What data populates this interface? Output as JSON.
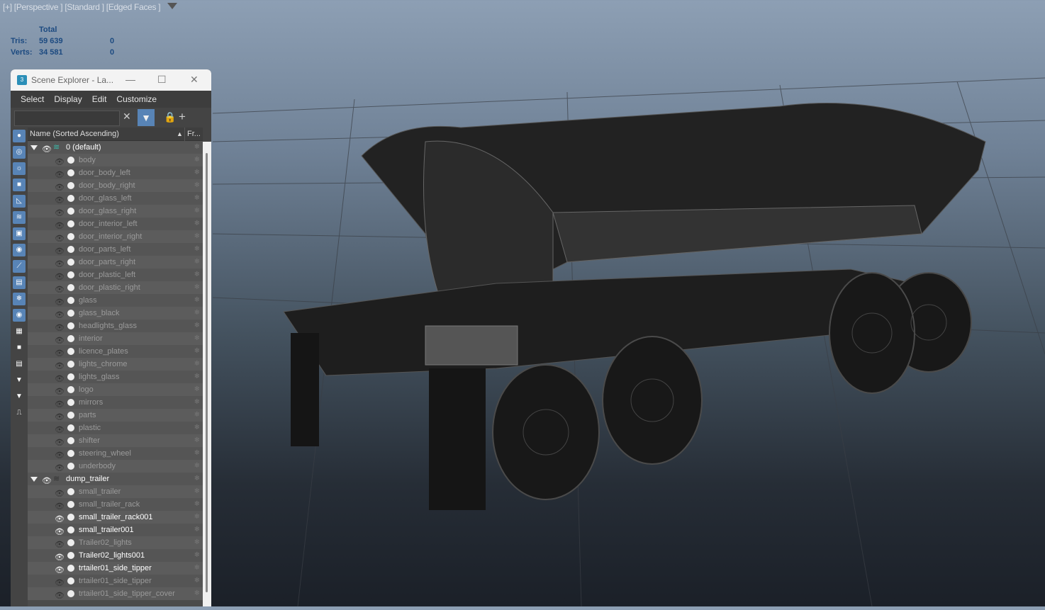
{
  "viewport": {
    "label": "[+] [Perspective ] [Standard ] [Edged Faces ]",
    "stats": {
      "header": "Total",
      "tris_label": "Tris:",
      "tris_total": "59 639",
      "tris_sel": "0",
      "verts_label": "Verts:",
      "verts_total": "34 581",
      "verts_sel": "0"
    }
  },
  "window": {
    "title": "Scene Explorer - La...",
    "app_icon": "3",
    "menu": [
      "Select",
      "Display",
      "Edit",
      "Customize"
    ],
    "search_placeholder": "",
    "column_name": "Name (Sorted Ascending)",
    "column_frozen": "Fr..."
  },
  "layers": [
    {
      "name": "0 (default)",
      "items": [
        {
          "name": "body",
          "visible": false
        },
        {
          "name": "door_body_left",
          "visible": false
        },
        {
          "name": "door_body_right",
          "visible": false
        },
        {
          "name": "door_glass_left",
          "visible": false
        },
        {
          "name": "door_glass_right",
          "visible": false
        },
        {
          "name": "door_interior_left",
          "visible": false
        },
        {
          "name": "door_interior_right",
          "visible": false
        },
        {
          "name": "door_parts_left",
          "visible": false
        },
        {
          "name": "door_parts_right",
          "visible": false
        },
        {
          "name": "door_plastic_left",
          "visible": false
        },
        {
          "name": "door_plastic_right",
          "visible": false
        },
        {
          "name": "glass",
          "visible": false
        },
        {
          "name": "glass_black",
          "visible": false
        },
        {
          "name": "headlights_glass",
          "visible": false
        },
        {
          "name": "interior",
          "visible": false
        },
        {
          "name": "licence_plates",
          "visible": false
        },
        {
          "name": "lights_chrome",
          "visible": false
        },
        {
          "name": "lights_glass",
          "visible": false
        },
        {
          "name": "logo",
          "visible": false
        },
        {
          "name": "mirrors",
          "visible": false
        },
        {
          "name": "parts",
          "visible": false
        },
        {
          "name": "plastic",
          "visible": false
        },
        {
          "name": "shifter",
          "visible": false
        },
        {
          "name": "steering_wheel",
          "visible": false
        },
        {
          "name": "underbody",
          "visible": false
        }
      ]
    },
    {
      "name": "dump_trailer",
      "items": [
        {
          "name": "small_trailer",
          "visible": false
        },
        {
          "name": "small_trailer_rack",
          "visible": false
        },
        {
          "name": "small_trailer_rack001",
          "visible": true
        },
        {
          "name": "small_trailer001",
          "visible": true
        },
        {
          "name": "Trailer02_lights",
          "visible": false
        },
        {
          "name": "Trailer02_lights001",
          "visible": true
        },
        {
          "name": "trtailer01_side_tipper",
          "visible": true
        },
        {
          "name": "trtailer01_side_tipper",
          "visible": false
        },
        {
          "name": "trtailer01_side_tipper_cover",
          "visible": false
        }
      ]
    }
  ]
}
